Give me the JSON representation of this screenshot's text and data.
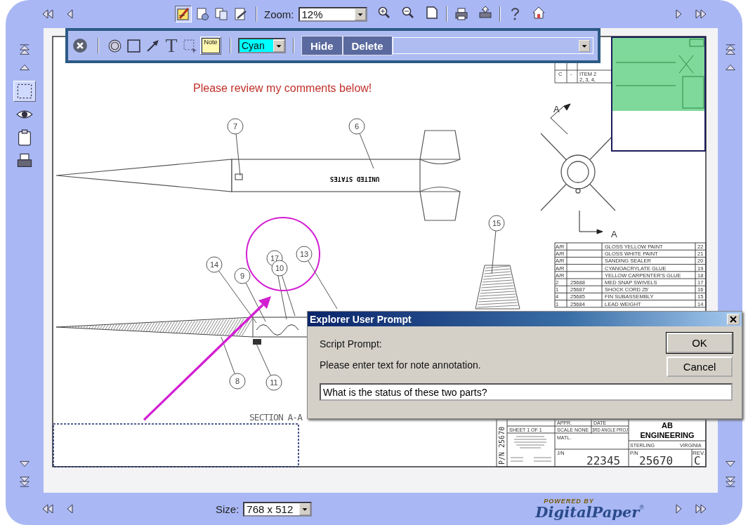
{
  "topbar": {
    "view_tools": [
      {
        "kind": "markup",
        "selected": true
      },
      {
        "kind": "page-settings",
        "selected": false
      },
      {
        "kind": "page-copy",
        "selected": false
      },
      {
        "kind": "page-edit",
        "selected": false
      }
    ],
    "zoom": {
      "label": "Zoom:",
      "value": "12%"
    }
  },
  "annotation_toolbar": {
    "tools": [
      {
        "kind": "circle",
        "selected": false
      },
      {
        "kind": "rectangle",
        "selected": false
      },
      {
        "kind": "arrow",
        "selected": false
      },
      {
        "kind": "text",
        "label": "T",
        "selected": false
      },
      {
        "kind": "area",
        "selected": false
      },
      {
        "kind": "note",
        "label": "Note",
        "selected": true
      }
    ],
    "color_select": {
      "value": "Cyan",
      "color": "#00ffff"
    },
    "buttons": [
      "Hide",
      "Delete"
    ]
  },
  "side_tools": [
    {
      "kind": "select",
      "selected": true
    },
    {
      "kind": "view",
      "selected": false
    },
    {
      "kind": "clipboard",
      "selected": false
    },
    {
      "kind": "print",
      "selected": false
    }
  ],
  "drawing": {
    "comment": "Please review my comments below!",
    "stamp": "UNITED STATES",
    "balloons": [
      "7",
      "6",
      "14",
      "9",
      "17",
      "10",
      "13",
      "15",
      "8",
      "11"
    ],
    "section_letters": [
      "A",
      "A"
    ],
    "section_label": "SECTION A-A",
    "revision": {
      "rev": "C",
      "zone": "-",
      "lines": [
        "ITEM 2",
        "2, 3, 4,"
      ]
    },
    "parts_list": [
      {
        "qty": "A/R",
        "description": "GLOSS YELLOW PAINT",
        "item": "22"
      },
      {
        "qty": "A/R",
        "description": "GLOSS WHITE PAINT",
        "item": "21"
      },
      {
        "qty": "A/R",
        "description": "SANDING SEALER",
        "item": "20"
      },
      {
        "qty": "A/R",
        "description": "CYANOACRYLATE GLUE",
        "item": "19"
      },
      {
        "qty": "A/R",
        "description": "YELLOW CARPENTER'S GLUE",
        "item": "18"
      },
      {
        "qty": "2",
        "part": "25688",
        "description": "MED SNAP SWIVELS",
        "item": "17"
      },
      {
        "qty": "1",
        "part": "25687",
        "description": "SHOCK CORD 25'",
        "item": "16"
      },
      {
        "qty": "4",
        "part": "25685",
        "description": "FIN SUBASSEMBLY",
        "item": "15"
      },
      {
        "qty": "1",
        "part": "25684",
        "description": "LEAD WEIGHT",
        "item": "14"
      }
    ],
    "title_block": {
      "side_pn": "P/N 25670",
      "sheet": "SHEET 1 OF 1",
      "appr": "APPR.",
      "date": "DATE",
      "scale": "SCALE NONE",
      "projection": "3RD ANGLE PROJ",
      "matl": "MATL.",
      "jn_label": "J/N",
      "jn": "22345",
      "company": "AB",
      "company_line2": "ENGINEERING",
      "city": "STERLING",
      "state": "VIRGINIA",
      "pn_label": "P/N",
      "pn": "25670",
      "rev_label": "REV.",
      "rev": "C"
    }
  },
  "dialog": {
    "title": "Explorer User Prompt",
    "prompt_label": "Script Prompt:",
    "message": "Please enter text for note annotation.",
    "value": "What is the status of these two parts?",
    "buttons": [
      {
        "label": "OK",
        "default": true
      },
      {
        "label": "Cancel",
        "default": false
      }
    ]
  },
  "bottombar": {
    "size": {
      "label": "Size:",
      "value": "768 x 512"
    },
    "logo": {
      "tagline": "POWERED BY",
      "name": "DigitalPaper",
      "mark": "®"
    }
  }
}
